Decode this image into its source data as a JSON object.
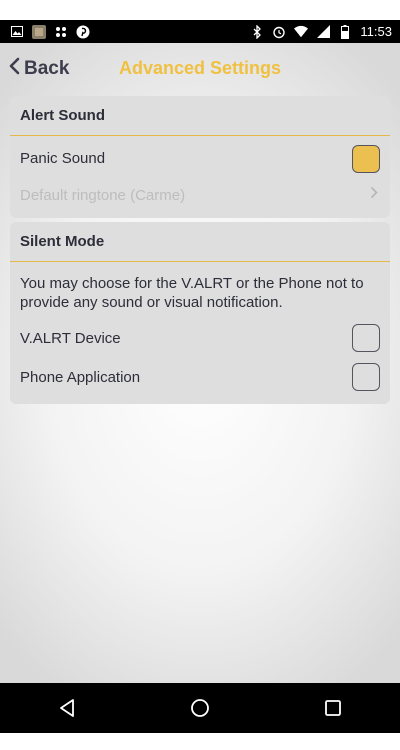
{
  "status_bar": {
    "time": "11:53",
    "left_icons": [
      "image-icon",
      "app-thumbnail-icon",
      "dots-icon",
      "pinterest-icon"
    ],
    "right_icons": [
      "bluetooth-icon",
      "alarm-icon",
      "wifi-icon",
      "signal-icon",
      "battery-icon"
    ]
  },
  "nav": {
    "back_label": "Back",
    "title": "Advanced Settings"
  },
  "alert_sound": {
    "header": "Alert Sound",
    "panic_label": "Panic Sound",
    "panic_checked": true,
    "ringtone_label": "Default ringtone (Carme)"
  },
  "silent_mode": {
    "header": "Silent Mode",
    "description": "You may choose for the V.ALRT or the Phone not to provide any sound or visual notification.",
    "device_label": "V.ALRT Device",
    "device_checked": false,
    "phone_label": "Phone Application",
    "phone_checked": false
  },
  "colors": {
    "accent": "#f0c040",
    "checkbox_checked": "#ecc050",
    "section_bg": "#dedede",
    "divider": "#e6b84a"
  },
  "android_nav": [
    "back-triangle-icon",
    "home-circle-icon",
    "recents-square-icon"
  ]
}
